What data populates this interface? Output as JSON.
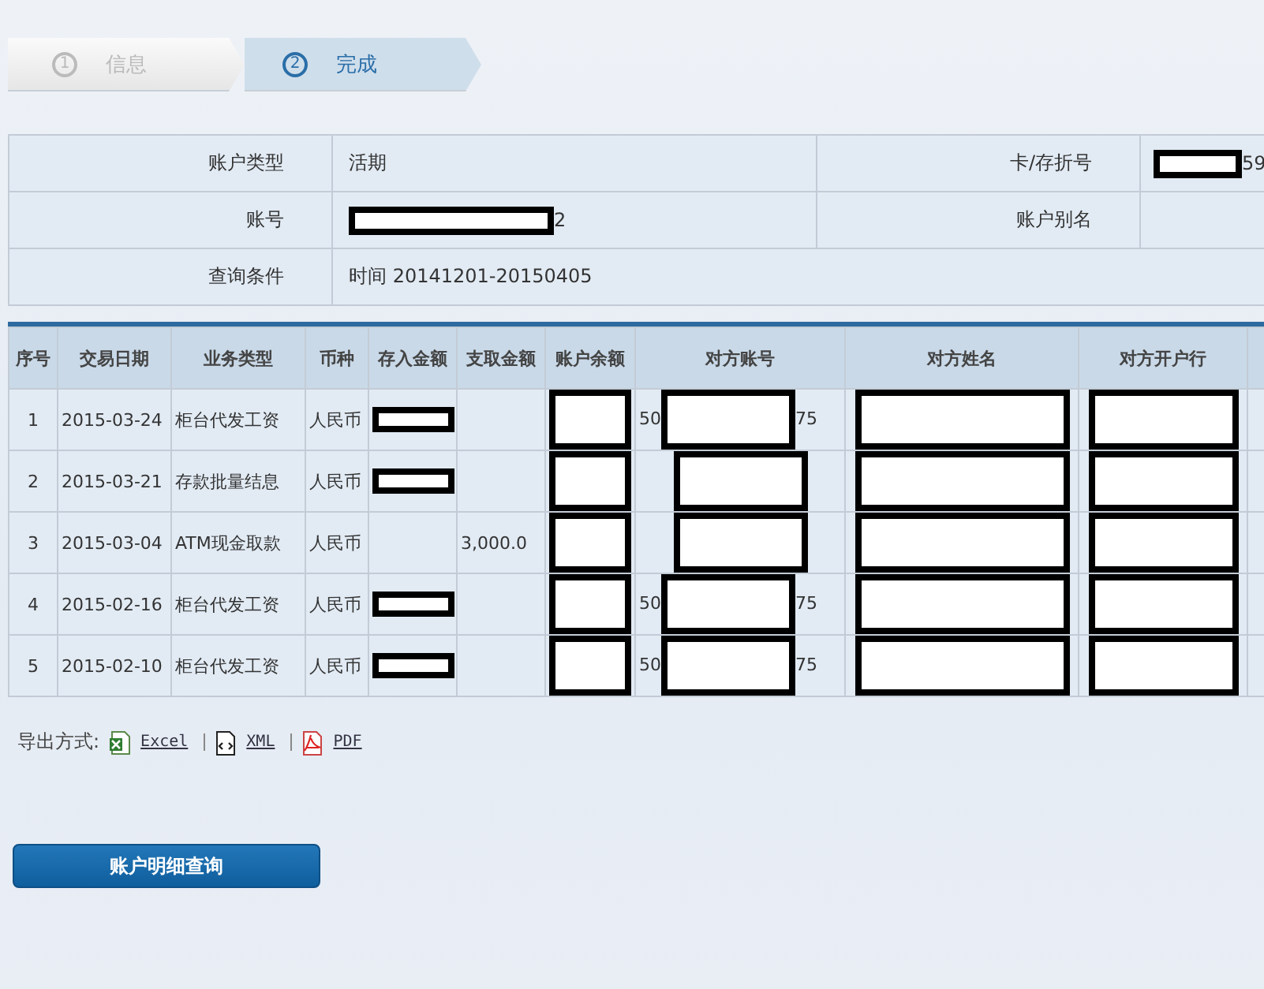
{
  "steps": [
    {
      "number": "1",
      "label": "信息",
      "selected": false
    },
    {
      "number": "2",
      "label": "完成",
      "selected": true
    }
  ],
  "account_info": [
    {
      "label": "账户类型",
      "value": {
        "text": "活期"
      },
      "label_2": "卡/存折号",
      "value_2": {
        "redacted": true,
        "suffix": "59"
      }
    },
    {
      "label": "账号",
      "value": {
        "redacted": true,
        "suffix": "2"
      },
      "label_2": "账户别名"
    },
    {
      "label": "查询条件",
      "value": {
        "text": "时间 20141201-20150405"
      }
    }
  ],
  "transactions": {
    "columns": [
      "序号",
      "交易日期",
      "业务类型",
      "币种",
      "存入金额",
      "支取金额",
      "账户余额",
      "对方账号",
      "对方姓名",
      "对方开户行"
    ],
    "rows": [
      [
        {
          "text": "1"
        },
        {
          "text": "2015-03-24"
        },
        {
          "text": "柜台代发工资"
        },
        {
          "text": "人民币"
        },
        {
          "redacted": true
        },
        {},
        {
          "redacted": true
        },
        {
          "redacted": true,
          "prefix": "50",
          "suffix": "75"
        },
        {
          "redacted": true
        },
        {
          "redacted": true
        }
      ],
      [
        {
          "text": "2"
        },
        {
          "text": "2015-03-21"
        },
        {
          "text": "存款批量结息"
        },
        {
          "text": "人民币"
        },
        {
          "redacted": true
        },
        {},
        {
          "redacted": true
        },
        {
          "redacted": true
        },
        {
          "redacted": true
        },
        {
          "redacted": true
        }
      ],
      [
        {
          "text": "3"
        },
        {
          "text": "2015-03-04"
        },
        {
          "text": "ATM现金取款"
        },
        {
          "text": "人民币"
        },
        {},
        {
          "text": "3,000.0"
        },
        {
          "redacted": true
        },
        {
          "redacted": true
        },
        {
          "redacted": true
        },
        {
          "redacted": true
        }
      ],
      [
        {
          "text": "4"
        },
        {
          "text": "2015-02-16"
        },
        {
          "text": "柜台代发工资"
        },
        {
          "text": "人民币"
        },
        {
          "redacted": true
        },
        {},
        {
          "redacted": true
        },
        {
          "redacted": true,
          "prefix": "50",
          "suffix": "75"
        },
        {
          "redacted": true
        },
        {
          "redacted": true
        }
      ],
      [
        {
          "text": "5"
        },
        {
          "text": "2015-02-10"
        },
        {
          "text": "柜台代发工资"
        },
        {
          "text": "人民币"
        },
        {
          "redacted": true
        },
        {},
        {
          "redacted": true
        },
        {
          "redacted": true,
          "prefix": "50",
          "suffix": "75"
        },
        {
          "redacted": true
        },
        {
          "redacted": true
        }
      ]
    ]
  },
  "export": {
    "label": "导出方式:",
    "links": [
      {
        "kind": "excel",
        "label": "Excel"
      },
      {
        "kind": "xml",
        "label": "XML"
      },
      {
        "kind": "pdf",
        "label": "PDF"
      }
    ]
  },
  "query_button": "账户明细查询"
}
